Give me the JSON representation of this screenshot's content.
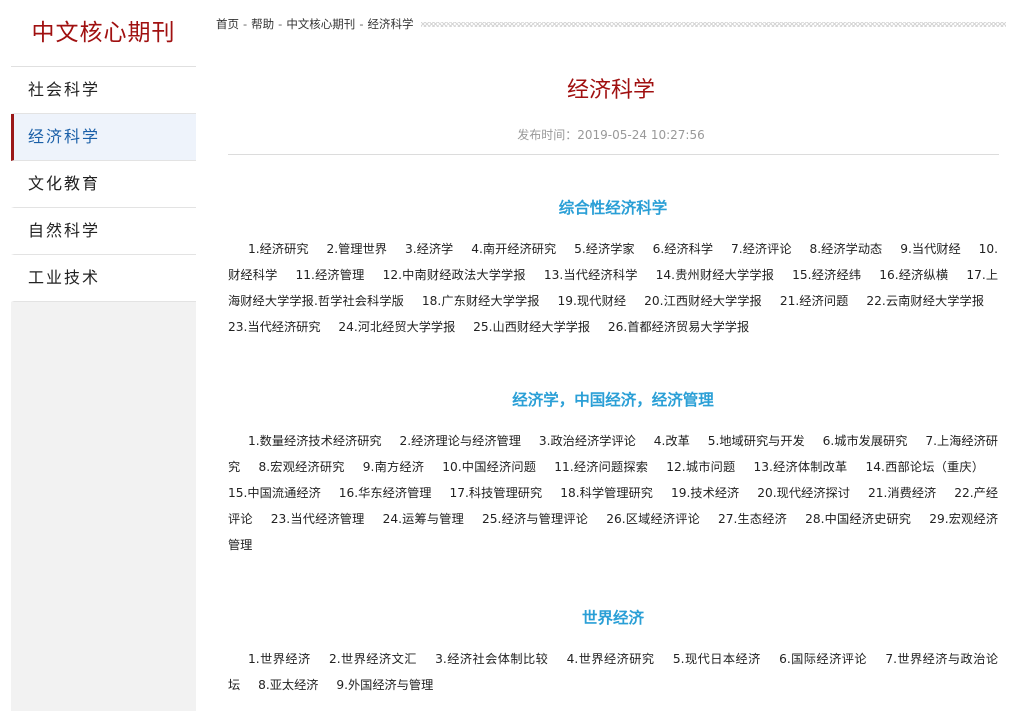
{
  "sidebar": {
    "site_title": "中文核心期刊",
    "items": [
      {
        "label": "社会科学"
      },
      {
        "label": "经济科学"
      },
      {
        "label": "文化教育"
      },
      {
        "label": "自然科学"
      },
      {
        "label": "工业技术"
      }
    ]
  },
  "breadcrumb": {
    "home": "首页",
    "help": "帮助",
    "category": "中文核心期刊",
    "current": "经济科学",
    "separator": "-"
  },
  "article": {
    "title": "经济科学",
    "publish_time": "发布时间：2019-05-24 10:27:56"
  },
  "sections": [
    {
      "title": "综合性经济科学",
      "journals": [
        "1.经济研究",
        "2.管理世界",
        "3.经济学",
        "4.南开经济研究",
        "5.经济学家",
        "6.经济科学",
        "7.经济评论",
        "8.经济学动态",
        "9.当代财经",
        "10.财经科学",
        "11.经济管理",
        "12.中南财经政法大学学报",
        "13.当代经济科学",
        "14.贵州财经大学学报",
        "15.经济经纬",
        "16.经济纵横",
        "17.上海财经大学学报.哲学社会科学版",
        "18.广东财经大学学报",
        "19.现代财经",
        "20.江西财经大学学报",
        "21.经济问题",
        "22.云南财经大学学报",
        "23.当代经济研究",
        "24.河北经贸大学学报",
        "25.山西财经大学学报",
        "26.首都经济贸易大学学报"
      ]
    },
    {
      "title": "经济学，中国经济，经济管理",
      "journals": [
        "1.数量经济技术经济研究",
        "2.经济理论与经济管理",
        "3.政治经济学评论",
        "4.改革",
        "5.地域研究与开发",
        "6.城市发展研究",
        "7.上海经济研究",
        "8.宏观经济研究",
        "9.南方经济",
        "10.中国经济问题",
        "11.经济问题探索",
        "12.城市问题",
        "13.经济体制改革",
        "14.西部论坛（重庆）",
        "15.中国流通经济",
        "16.华东经济管理",
        "17.科技管理研究",
        "18.科学管理研究",
        "19.技术经济",
        "20.现代经济探讨",
        "21.消费经济",
        "22.产经评论",
        "23.当代经济管理",
        "24.运筹与管理",
        "25.经济与管理评论",
        "26.区域经济评论",
        "27.生态经济",
        "28.中国经济史研究",
        "29.宏观经济管理"
      ]
    },
    {
      "title": "世界经济",
      "journals": [
        "1.世界经济",
        "2.世界经济文汇",
        "3.经济社会体制比较",
        "4.世界经济研究",
        "5.现代日本经济",
        "6.国际经济评论",
        "7.世界经济与政治论坛",
        "8.亚太经济",
        "9.外国经济与管理"
      ]
    }
  ],
  "colors": {
    "brand_red": "#a01010",
    "section_blue": "#2a9fd6",
    "active_nav_text": "#1a5fa8"
  }
}
